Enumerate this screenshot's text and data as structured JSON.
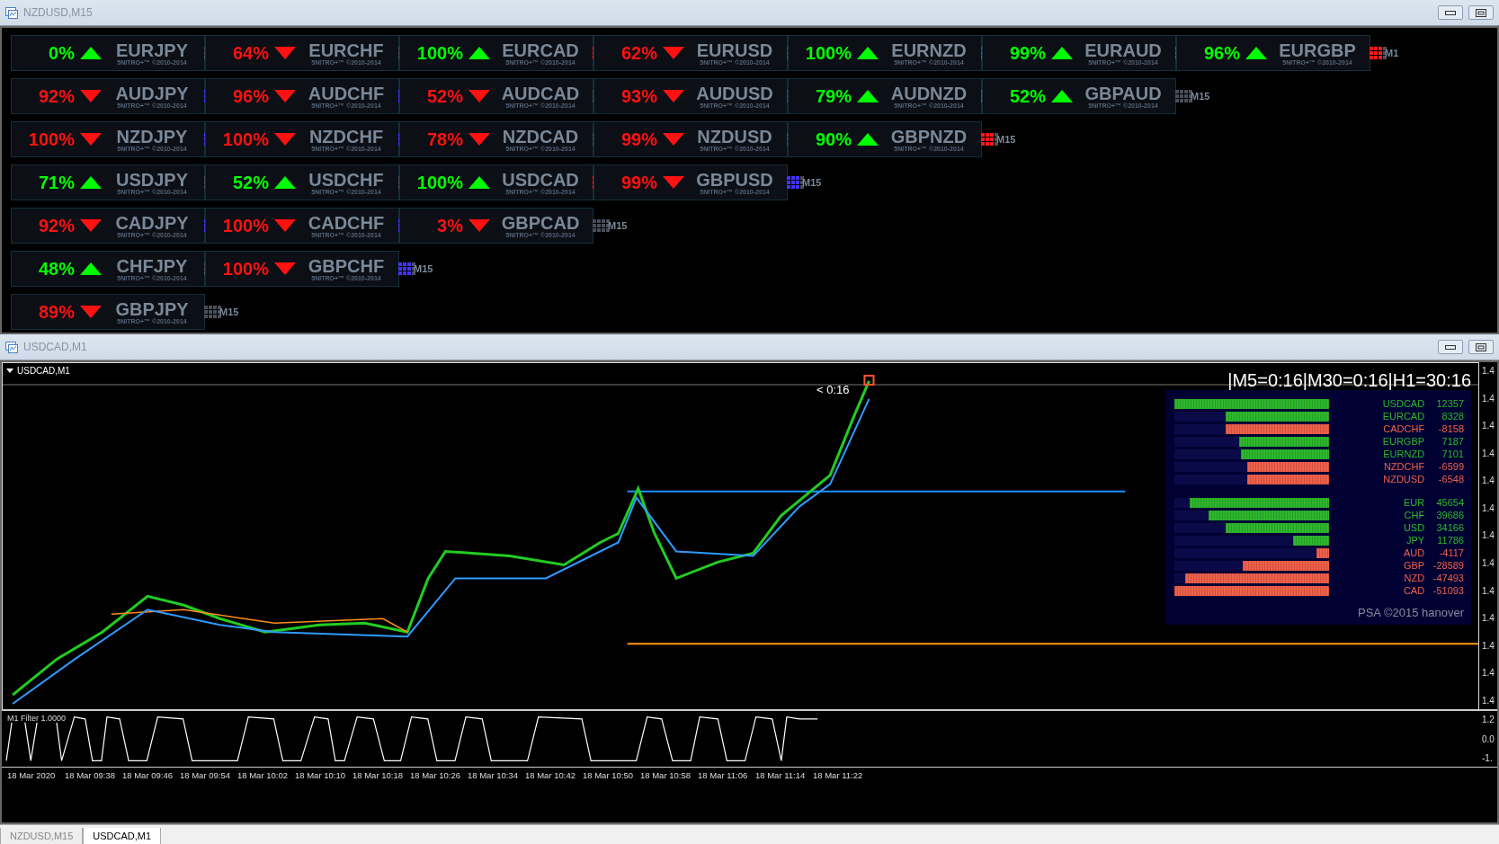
{
  "top_window": {
    "title": "NZDUSD,M15",
    "rows": [
      {
        "tiles": [
          {
            "percent": "0%",
            "rising": true,
            "pair": "EURJPY",
            "watermark": "5NITRO+™ ©2010-2014",
            "color": "#4a4f5a"
          },
          {
            "percent": "64%",
            "rising": false,
            "pair": "EURCHF",
            "watermark": "5NITRO+™ ©2010-2014",
            "color": "#4a4f5a"
          },
          {
            "percent": "100%",
            "rising": true,
            "pair": "EURCAD",
            "watermark": "5NITRO+™ ©2010-2014",
            "color": "#ff1a1a"
          },
          {
            "percent": "62%",
            "rising": false,
            "pair": "EURUSD",
            "watermark": "5NITRO+™ ©2010-2014",
            "color": "#4a4f5a"
          },
          {
            "percent": "100%",
            "rising": true,
            "pair": "EURNZD",
            "watermark": "5NITRO+™ ©2010-2014",
            "color": "#ff1a1a"
          },
          {
            "percent": "99%",
            "rising": true,
            "pair": "EURAUD",
            "watermark": "5NITRO+™ ©2010-2014",
            "color": "#ff1a1a"
          },
          {
            "percent": "96%",
            "rising": true,
            "pair": "EURGBP",
            "watermark": "5NITRO+™ ©2010-2014",
            "color": "#ff1a1a"
          }
        ],
        "timeframe": "M1"
      },
      {
        "tiles": [
          {
            "percent": "92%",
            "rising": false,
            "pair": "AUDJPY",
            "watermark": "5NITRO+™ ©2010-2014",
            "color": "#4433ff"
          },
          {
            "percent": "96%",
            "rising": false,
            "pair": "AUDCHF",
            "watermark": "5NITRO+™ ©2010-2014",
            "color": "#4433ff"
          },
          {
            "percent": "52%",
            "rising": false,
            "pair": "AUDCAD",
            "watermark": "5NITRO+™ ©2010-2014",
            "color": "#4a4f5a"
          },
          {
            "percent": "93%",
            "rising": false,
            "pair": "AUDUSD",
            "watermark": "5NITRO+™ ©2010-2014",
            "color": "#4433ff"
          },
          {
            "percent": "79%",
            "rising": true,
            "pair": "AUDNZD",
            "watermark": "5NITRO+™ ©2010-2014",
            "color": "#ff1a1a"
          },
          {
            "percent": "52%",
            "rising": true,
            "pair": "GBPAUD",
            "watermark": "5NITRO+™ ©2010-2014",
            "color": "#4a4f5a"
          }
        ],
        "timeframe": "M15"
      },
      {
        "tiles": [
          {
            "percent": "100%",
            "rising": false,
            "pair": "NZDJPY",
            "watermark": "5NITRO+™ ©2010-2014",
            "color": "#4433ff"
          },
          {
            "percent": "100%",
            "rising": false,
            "pair": "NZDCHF",
            "watermark": "5NITRO+™ ©2010-2014",
            "color": "#4433ff"
          },
          {
            "percent": "78%",
            "rising": false,
            "pair": "NZDCAD",
            "watermark": "5NITRO+™ ©2010-2014",
            "color": "#4a4f5a"
          },
          {
            "percent": "99%",
            "rising": false,
            "pair": "NZDUSD",
            "watermark": "5NITRO+™ ©2010-2014",
            "color": "#4433ff"
          },
          {
            "percent": "90%",
            "rising": true,
            "pair": "GBPNZD",
            "watermark": "5NITRO+™ ©2010-2014",
            "color": "#ff1a1a"
          }
        ],
        "timeframe": "M15"
      },
      {
        "tiles": [
          {
            "percent": "71%",
            "rising": true,
            "pair": "USDJPY",
            "watermark": "5NITRO+™ ©2010-2014",
            "color": "#4a4f5a"
          },
          {
            "percent": "52%",
            "rising": true,
            "pair": "USDCHF",
            "watermark": "5NITRO+™ ©2010-2014",
            "color": "#4a4f5a"
          },
          {
            "percent": "100%",
            "rising": true,
            "pair": "USDCAD",
            "watermark": "5NITRO+™ ©2010-2014",
            "color": "#ff1a1a"
          },
          {
            "percent": "99%",
            "rising": false,
            "pair": "GBPUSD",
            "watermark": "5NITRO+™ ©2010-2014",
            "color": "#4433ff"
          }
        ],
        "timeframe": "M15"
      },
      {
        "tiles": [
          {
            "percent": "92%",
            "rising": false,
            "pair": "CADJPY",
            "watermark": "5NITRO+™ ©2010-2014",
            "color": "#4433ff"
          },
          {
            "percent": "100%",
            "rising": false,
            "pair": "CADCHF",
            "watermark": "5NITRO+™ ©2010-2014",
            "color": "#4433ff"
          },
          {
            "percent": "3%",
            "rising": false,
            "pair": "GBPCAD",
            "watermark": "5NITRO+™ ©2010-2014",
            "color": "#4a4f5a"
          }
        ],
        "timeframe": "M15"
      },
      {
        "tiles": [
          {
            "percent": "48%",
            "rising": true,
            "pair": "CHFJPY",
            "watermark": "5NITRO+™ ©2010-2014",
            "color": "#4a4f5a"
          },
          {
            "percent": "100%",
            "rising": false,
            "pair": "GBPCHF",
            "watermark": "5NITRO+™ ©2010-2014",
            "color": "#4433ff"
          }
        ],
        "timeframe": "M15"
      },
      {
        "tiles": [
          {
            "percent": "89%",
            "rising": false,
            "pair": "GBPJPY",
            "watermark": "5NITRO+™ ©2010-2014",
            "color": "#4a4f5a"
          }
        ],
        "timeframe": "M15"
      }
    ]
  },
  "chart_window": {
    "title": "USDCAD,M1",
    "legend": "USDCAD,M1",
    "timer": "|M5=0:16|M30=0:16|H1=30:16",
    "countdown": "< 0:16",
    "strength": {
      "pairs": [
        {
          "name": "USDCAD",
          "value": "12357",
          "level": 1,
          "color": "#2db82d"
        },
        {
          "name": "EURCAD",
          "value": "8328",
          "level": 0.67,
          "color": "#2db82d"
        },
        {
          "name": "CADCHF",
          "value": "-8158",
          "level": 0.67,
          "color": "#f0604a"
        },
        {
          "name": "EURGBP",
          "value": "7187",
          "level": 0.58,
          "color": "#2db82d"
        },
        {
          "name": "EURNZD",
          "value": "7101",
          "level": 0.57,
          "color": "#2db82d"
        },
        {
          "name": "NZDCHF",
          "value": "-6599",
          "level": 0.53,
          "color": "#f0604a"
        },
        {
          "name": "NZDUSD",
          "value": "-6548",
          "level": 0.53,
          "color": "#f0604a"
        }
      ],
      "currencies": [
        {
          "name": "EUR",
          "value": "45654",
          "level": 0.9,
          "color": "#2db82d"
        },
        {
          "name": "CHF",
          "value": "39686",
          "level": 0.78,
          "color": "#2db82d"
        },
        {
          "name": "USD",
          "value": "34166",
          "level": 0.67,
          "color": "#2db82d"
        },
        {
          "name": "JPY",
          "value": "11786",
          "level": 0.23,
          "color": "#2db82d"
        },
        {
          "name": "AUD",
          "value": "-4117",
          "level": 0.08,
          "color": "#f0604a"
        },
        {
          "name": "GBP",
          "value": "-28589",
          "level": 0.56,
          "color": "#f0604a"
        },
        {
          "name": "NZD",
          "value": "-47493",
          "level": 0.93,
          "color": "#f0604a"
        },
        {
          "name": "CAD",
          "value": "-51093",
          "level": 1,
          "color": "#f0604a"
        }
      ],
      "credit": "PSA ©2015 hanover"
    },
    "price_axis": [
      "1.4",
      "1.4",
      "1.4",
      "1.4",
      "1.4",
      "1.4",
      "1.4",
      "1.4",
      "1.4",
      "1.4",
      "1.4",
      "1.4",
      "1.4"
    ],
    "indicator": {
      "label": "M1 Filter 1.0000",
      "axis": [
        "1.2",
        "0.0",
        "-1."
      ]
    },
    "time_axis": [
      "18 Mar 2020",
      "18 Mar 09:38",
      "18 Mar 09:46",
      "18 Mar 09:54",
      "18 Mar 10:02",
      "18 Mar 10:10",
      "18 Mar 10:18",
      "18 Mar 10:26",
      "18 Mar 10:34",
      "18 Mar 10:42",
      "18 Mar 10:50",
      "18 Mar 10:58",
      "18 Mar 11:06",
      "18 Mar 11:14",
      "18 Mar 11:22"
    ]
  },
  "tabs": [
    {
      "label": "NZDUSD,M15",
      "selected": false
    },
    {
      "label": "USDCAD,M1",
      "selected": true
    }
  ]
}
